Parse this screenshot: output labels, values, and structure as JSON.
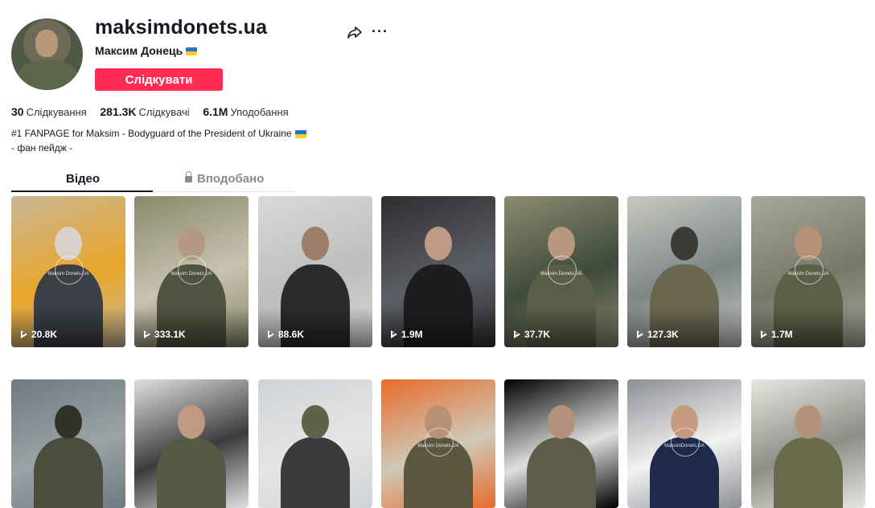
{
  "profile": {
    "username": "maksimdonets.ua",
    "nickname": "Максим Донець",
    "follow_label": "Слідкувати",
    "bio_line1": "#1 FANPAGE for Maksim - Bodyguard of the President of Ukraine",
    "bio_line2": "- фан пейдж -"
  },
  "stats": {
    "following_count": "30",
    "following_label": "Слідкування",
    "followers_count": "281.3K",
    "followers_label": "Слідкувачі",
    "likes_count": "6.1M",
    "likes_label": "Уподобання"
  },
  "tabs": {
    "videos": "Відео",
    "liked": "Вподобано"
  },
  "icons": {
    "share": "share-icon",
    "more": "more-icon",
    "lock": "lock-icon",
    "play": "play-icon",
    "flag": "ukraine-flag-icon"
  },
  "colors": {
    "accent": "#fe2c55",
    "text": "#161823",
    "muted": "#8a8b91"
  },
  "videos": [
    {
      "views": "20.8K",
      "watermark": "Maksim Donets.UA",
      "palette": [
        "#c9b796",
        "#3c3f45",
        "#d8d2c8",
        "#e9a62a"
      ]
    },
    {
      "views": "333.1K",
      "watermark": "Maksim Donets.UA",
      "palette": [
        "#8a8a6a",
        "#4f5440",
        "#b49a80",
        "#c8c2b0"
      ]
    },
    {
      "views": "88.6K",
      "watermark": "",
      "palette": [
        "#d9d9d7",
        "#2a2b2c",
        "#9c7d68",
        "#bdbdbb"
      ]
    },
    {
      "views": "1.9M",
      "watermark": "",
      "palette": [
        "#2e2e30",
        "#1d1d1f",
        "#c19a85",
        "#5c5f66"
      ]
    },
    {
      "views": "37.7K",
      "watermark": "Maksim Donets.UA",
      "palette": [
        "#8d8b70",
        "#5b5e47",
        "#b8977f",
        "#3e4a3a"
      ]
    },
    {
      "views": "127.3K",
      "watermark": "",
      "palette": [
        "#c7c8c3",
        "#6b6650",
        "#3d3b35",
        "#7e8784"
      ]
    },
    {
      "views": "1.7M",
      "watermark": "Maksim Donets.UA",
      "palette": [
        "#a7a89a",
        "#5b6046",
        "#b89278",
        "#77786a"
      ]
    },
    {
      "views": "",
      "watermark": "",
      "palette": [
        "#6e7a80",
        "#4a4e3c",
        "#2f3328",
        "#9aa3a6"
      ]
    },
    {
      "views": "",
      "watermark": "",
      "palette": [
        "#dfe0e0",
        "#555a44",
        "#c09a80",
        "#3b3c3e"
      ]
    },
    {
      "views": "",
      "watermark": "",
      "palette": [
        "#cfd3d6",
        "#3a3b3d",
        "#5e6248",
        "#e5e5e5"
      ]
    },
    {
      "views": "",
      "watermark": "Maksim Donets.UA",
      "palette": [
        "#e86b2b",
        "#5a563f",
        "#b99276",
        "#cfc9b8"
      ]
    },
    {
      "views": "",
      "watermark": "",
      "palette": [
        "#000000",
        "#5e5d49",
        "#b4917b",
        "#e0e0e0"
      ]
    },
    {
      "views": "",
      "watermark": "MaksimDonets.UA",
      "palette": [
        "#8c8f94",
        "#1e2a4a",
        "#c59a7e",
        "#f2f2f2"
      ]
    },
    {
      "views": "",
      "watermark": "",
      "palette": [
        "#e8e6e0",
        "#6a6a4c",
        "#b3937b",
        "#8b8f86"
      ]
    }
  ]
}
